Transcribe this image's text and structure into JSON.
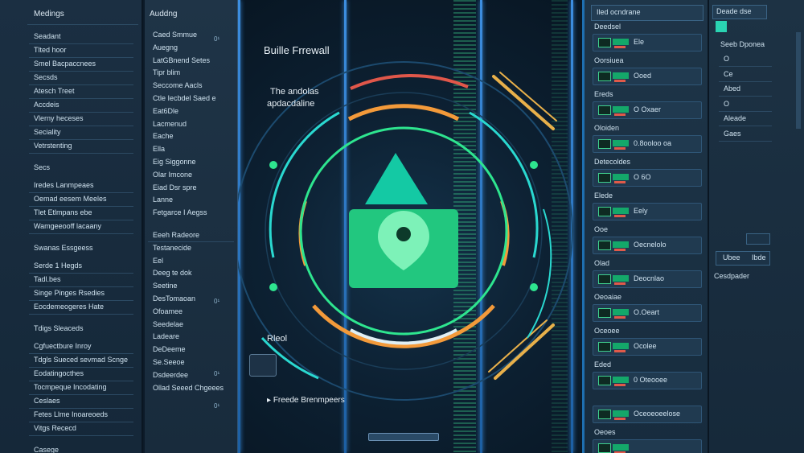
{
  "col1": {
    "header": "Medings",
    "groups": [
      {
        "items": [
          "Seadant",
          "Tlted hoor",
          "Smel Bacpaccnees",
          "Secsds",
          "Atesch Treet",
          "Accdeis",
          "Vlerny heceses",
          "Seciality",
          "Vetrstenting"
        ]
      },
      {
        "title": "Secs",
        "items": [
          "Iredes Lanmpeaes",
          "Oemad eesem Meeles",
          "Tlet Etlmpans ebe",
          "Wamgeeooff lacaany"
        ]
      },
      {
        "title": "Swanas Essgeess",
        "items": [
          "Serde 1 Hegds",
          "Tadl.bes",
          "Singe Pinges Rsedies",
          "Eocdemeogeres Hate"
        ]
      },
      {
        "title": "Tdigs Sleaceds",
        "items": [
          "Cgfuectbure Inroy",
          "Tdgls Sueced sevmad Scnge",
          "Eodatingocthes",
          "Tocmpeque Incodating",
          "Ceslaes",
          "Fetes Llme Inoareoeds",
          "Vitgs Rececd"
        ]
      },
      {
        "title": "Casege"
      }
    ]
  },
  "col2": {
    "header": "Auddng",
    "items": [
      "Caed Smmue",
      "Auegng",
      "LatGBnend Setes",
      "Tipr blim",
      "Seccome Aacls",
      "Ctle Iecbdel Saed e",
      "Eat6Dle",
      "Lacmenud",
      "Eache",
      "Ella",
      "Eig Siggonne",
      "Olar Imcone",
      "Eiad Dsr spre",
      "Lanne",
      "Fetgarce I Aegss",
      "Eeeh Radeore",
      "Testanecide",
      "Eel",
      "Deeg te dok",
      "Seetine",
      "DesTomaoan",
      "Ofoamee",
      "Seedelae",
      "Ladeare",
      "DeDeeme",
      "Se.Seeoe",
      "Dsdeerdee",
      "Ollad Seeed Chgeees"
    ],
    "counts": [
      "0¹",
      "0¹",
      "0¹",
      "0¹"
    ]
  },
  "center": {
    "title": "Buille Frrewall",
    "subtitle_line1": "The andolas",
    "subtitle_line2": "apdacdaline",
    "side_label": "Rleol",
    "bottom_link": "Freede Brenmpeers",
    "colors": {
      "accent": "#2ee58f",
      "orange": "#f39a3a",
      "teal": "#2ad8d0",
      "red": "#e0574a",
      "yellow": "#e8b04a"
    },
    "icons": [
      "shield-location-icon",
      "triangle-icon",
      "pin-icon"
    ]
  },
  "col4": {
    "search": "Iled ocndrane",
    "sections": [
      {
        "title": "Deedsel",
        "row": "Ele"
      },
      {
        "title": "Oorsiuea",
        "row": "Ooed"
      },
      {
        "title": "Ereds",
        "row": "O Oxaer"
      },
      {
        "title": "Oloiden",
        "row": "0.8ooloo oa"
      },
      {
        "title": "Detecoldes",
        "row": "O 6O"
      },
      {
        "title": "Elede",
        "row": "Eely"
      },
      {
        "title": "Ooe",
        "row": "Oecnelolo"
      },
      {
        "title": "Olad",
        "row": "Deocnlao"
      },
      {
        "title": "Oeoaiae",
        "row": "O.Oeart"
      },
      {
        "title": "Oceoee",
        "row": "Ocolee"
      },
      {
        "title": "Eded",
        "row": "0 Oteooee"
      },
      {
        "title": "",
        "row": "Oceoeoeelose"
      },
      {
        "title": "Oeoes",
        "row": ""
      }
    ]
  },
  "col5": {
    "top": "Deade dse",
    "label": "Seeb Dponea",
    "options": [
      "O",
      "Ce",
      "Abed",
      "O",
      "Aleade",
      "Gaes"
    ],
    "tab_left": "Ubee",
    "tab_right": "Ibde",
    "footer": "Cesdpader"
  }
}
